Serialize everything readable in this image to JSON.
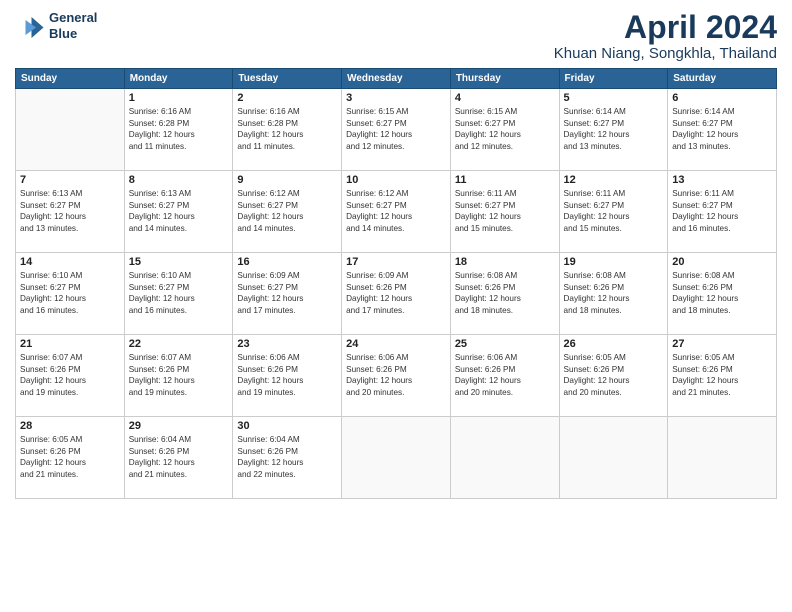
{
  "logo": {
    "line1": "General",
    "line2": "Blue"
  },
  "title": "April 2024",
  "location": "Khuan Niang, Songkhla, Thailand",
  "weekdays": [
    "Sunday",
    "Monday",
    "Tuesday",
    "Wednesday",
    "Thursday",
    "Friday",
    "Saturday"
  ],
  "weeks": [
    [
      {
        "day": "",
        "info": ""
      },
      {
        "day": "1",
        "info": "Sunrise: 6:16 AM\nSunset: 6:28 PM\nDaylight: 12 hours\nand 11 minutes."
      },
      {
        "day": "2",
        "info": "Sunrise: 6:16 AM\nSunset: 6:28 PM\nDaylight: 12 hours\nand 11 minutes."
      },
      {
        "day": "3",
        "info": "Sunrise: 6:15 AM\nSunset: 6:27 PM\nDaylight: 12 hours\nand 12 minutes."
      },
      {
        "day": "4",
        "info": "Sunrise: 6:15 AM\nSunset: 6:27 PM\nDaylight: 12 hours\nand 12 minutes."
      },
      {
        "day": "5",
        "info": "Sunrise: 6:14 AM\nSunset: 6:27 PM\nDaylight: 12 hours\nand 13 minutes."
      },
      {
        "day": "6",
        "info": "Sunrise: 6:14 AM\nSunset: 6:27 PM\nDaylight: 12 hours\nand 13 minutes."
      }
    ],
    [
      {
        "day": "7",
        "info": "Sunrise: 6:13 AM\nSunset: 6:27 PM\nDaylight: 12 hours\nand 13 minutes."
      },
      {
        "day": "8",
        "info": "Sunrise: 6:13 AM\nSunset: 6:27 PM\nDaylight: 12 hours\nand 14 minutes."
      },
      {
        "day": "9",
        "info": "Sunrise: 6:12 AM\nSunset: 6:27 PM\nDaylight: 12 hours\nand 14 minutes."
      },
      {
        "day": "10",
        "info": "Sunrise: 6:12 AM\nSunset: 6:27 PM\nDaylight: 12 hours\nand 14 minutes."
      },
      {
        "day": "11",
        "info": "Sunrise: 6:11 AM\nSunset: 6:27 PM\nDaylight: 12 hours\nand 15 minutes."
      },
      {
        "day": "12",
        "info": "Sunrise: 6:11 AM\nSunset: 6:27 PM\nDaylight: 12 hours\nand 15 minutes."
      },
      {
        "day": "13",
        "info": "Sunrise: 6:11 AM\nSunset: 6:27 PM\nDaylight: 12 hours\nand 16 minutes."
      }
    ],
    [
      {
        "day": "14",
        "info": "Sunrise: 6:10 AM\nSunset: 6:27 PM\nDaylight: 12 hours\nand 16 minutes."
      },
      {
        "day": "15",
        "info": "Sunrise: 6:10 AM\nSunset: 6:27 PM\nDaylight: 12 hours\nand 16 minutes."
      },
      {
        "day": "16",
        "info": "Sunrise: 6:09 AM\nSunset: 6:27 PM\nDaylight: 12 hours\nand 17 minutes."
      },
      {
        "day": "17",
        "info": "Sunrise: 6:09 AM\nSunset: 6:26 PM\nDaylight: 12 hours\nand 17 minutes."
      },
      {
        "day": "18",
        "info": "Sunrise: 6:08 AM\nSunset: 6:26 PM\nDaylight: 12 hours\nand 18 minutes."
      },
      {
        "day": "19",
        "info": "Sunrise: 6:08 AM\nSunset: 6:26 PM\nDaylight: 12 hours\nand 18 minutes."
      },
      {
        "day": "20",
        "info": "Sunrise: 6:08 AM\nSunset: 6:26 PM\nDaylight: 12 hours\nand 18 minutes."
      }
    ],
    [
      {
        "day": "21",
        "info": "Sunrise: 6:07 AM\nSunset: 6:26 PM\nDaylight: 12 hours\nand 19 minutes."
      },
      {
        "day": "22",
        "info": "Sunrise: 6:07 AM\nSunset: 6:26 PM\nDaylight: 12 hours\nand 19 minutes."
      },
      {
        "day": "23",
        "info": "Sunrise: 6:06 AM\nSunset: 6:26 PM\nDaylight: 12 hours\nand 19 minutes."
      },
      {
        "day": "24",
        "info": "Sunrise: 6:06 AM\nSunset: 6:26 PM\nDaylight: 12 hours\nand 20 minutes."
      },
      {
        "day": "25",
        "info": "Sunrise: 6:06 AM\nSunset: 6:26 PM\nDaylight: 12 hours\nand 20 minutes."
      },
      {
        "day": "26",
        "info": "Sunrise: 6:05 AM\nSunset: 6:26 PM\nDaylight: 12 hours\nand 20 minutes."
      },
      {
        "day": "27",
        "info": "Sunrise: 6:05 AM\nSunset: 6:26 PM\nDaylight: 12 hours\nand 21 minutes."
      }
    ],
    [
      {
        "day": "28",
        "info": "Sunrise: 6:05 AM\nSunset: 6:26 PM\nDaylight: 12 hours\nand 21 minutes."
      },
      {
        "day": "29",
        "info": "Sunrise: 6:04 AM\nSunset: 6:26 PM\nDaylight: 12 hours\nand 21 minutes."
      },
      {
        "day": "30",
        "info": "Sunrise: 6:04 AM\nSunset: 6:26 PM\nDaylight: 12 hours\nand 22 minutes."
      },
      {
        "day": "",
        "info": ""
      },
      {
        "day": "",
        "info": ""
      },
      {
        "day": "",
        "info": ""
      },
      {
        "day": "",
        "info": ""
      }
    ]
  ]
}
